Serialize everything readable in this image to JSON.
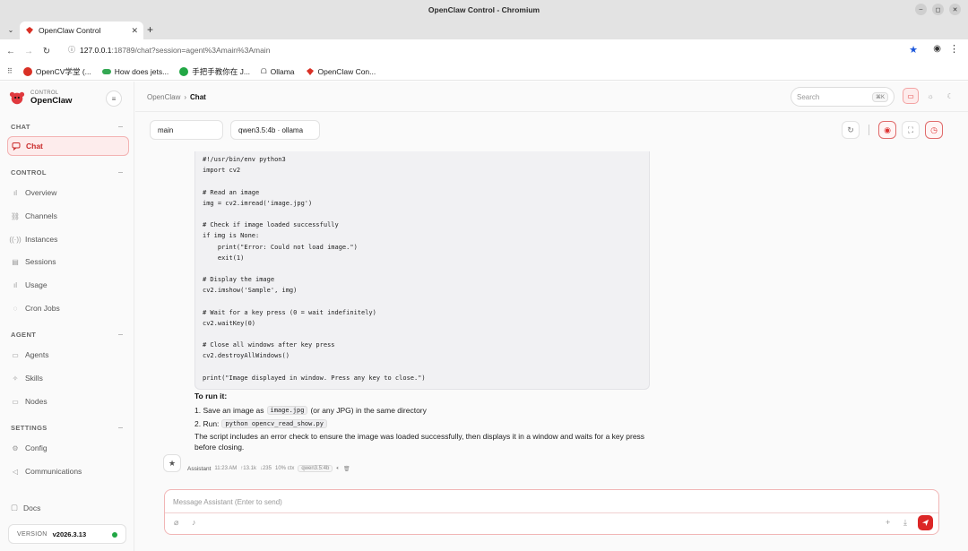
{
  "window": {
    "title": "OpenClaw Control - Chromium"
  },
  "tab": {
    "title": "OpenClaw Control"
  },
  "address": {
    "host": "127.0.0.1",
    "rest": ":18789/chat?session=agent%3Amain%3Amain"
  },
  "bookmarks": [
    {
      "label": "OpenCV学堂 (...",
      "color": "#d93025"
    },
    {
      "label": "How does jets...",
      "color": "#34a853"
    },
    {
      "label": "手把手教你在 J...",
      "color": "#22a745"
    },
    {
      "label": "Ollama",
      "color": "#555555"
    },
    {
      "label": "OpenClaw Con...",
      "color": "#d93025"
    }
  ],
  "brand": {
    "small": "CONTROL",
    "name": "OpenClaw"
  },
  "sidebar": {
    "sections": [
      {
        "title": "CHAT",
        "items": [
          {
            "label": "Chat",
            "icon": "chat-bubble-icon",
            "active": true
          }
        ]
      },
      {
        "title": "CONTROL",
        "items": [
          {
            "label": "Overview",
            "icon": "bar-chart-icon"
          },
          {
            "label": "Channels",
            "icon": "link-icon"
          },
          {
            "label": "Instances",
            "icon": "radio-icon"
          },
          {
            "label": "Sessions",
            "icon": "document-icon"
          },
          {
            "label": "Usage",
            "icon": "bar-chart-icon"
          },
          {
            "label": "Cron Jobs",
            "icon": "clock-icon"
          }
        ]
      },
      {
        "title": "AGENT",
        "items": [
          {
            "label": "Agents",
            "icon": "folder-icon"
          },
          {
            "label": "Skills",
            "icon": "sparkle-icon"
          },
          {
            "label": "Nodes",
            "icon": "monitor-icon"
          }
        ]
      },
      {
        "title": "SETTINGS",
        "items": [
          {
            "label": "Config",
            "icon": "gear-icon"
          },
          {
            "label": "Communications",
            "icon": "send-icon"
          }
        ]
      }
    ],
    "docs": "Docs",
    "version_label": "VERSION",
    "version": "v2026.3.13"
  },
  "breadcrumb": {
    "root": "OpenClaw",
    "sep": "›",
    "current": "Chat"
  },
  "search": {
    "placeholder": "Search",
    "shortcut": "⌘K"
  },
  "session": {
    "name": "main",
    "model": "qwen3.5:4b · ollama"
  },
  "code_lines": [
    "#!/usr/bin/env python3",
    "import cv2",
    "",
    "# Read an image",
    "img = cv2.imread('image.jpg')",
    "",
    "# Check if image loaded successfully",
    "if img is None:",
    "    print(\"Error: Could not load image.\")",
    "    exit(1)",
    "",
    "# Display the image",
    "cv2.imshow('Sample', img)",
    "",
    "# Wait for a key press (0 = wait indefinitely)",
    "cv2.waitKey(0)",
    "",
    "# Close all windows after key press",
    "cv2.destroyAllWindows()",
    "",
    "print(\"Image displayed in window. Press any key to close.\")"
  ],
  "message": {
    "run_heading": "To run it:",
    "step1_pre": "1. Save an image as",
    "step1_code": "image.jpg",
    "step1_post": "(or any JPG) in the same directory",
    "step2_pre": "2. Run:",
    "step2_code": "python opencv_read_show.py",
    "para": "The script includes an error check to ensure the image was loaded successfully, then displays it in a window and waits for a key press before closing."
  },
  "meta": {
    "author": "Assistant",
    "time": "11:23 AM",
    "tokens_in": "↑13.1k",
    "tokens_out": "↓235",
    "ctx": "10% ctx",
    "model": "qwen3.5:4b"
  },
  "composer": {
    "placeholder": "Message Assistant (Enter to send)"
  },
  "colors": {
    "accent": "#dc2626",
    "online": "#22a745"
  }
}
